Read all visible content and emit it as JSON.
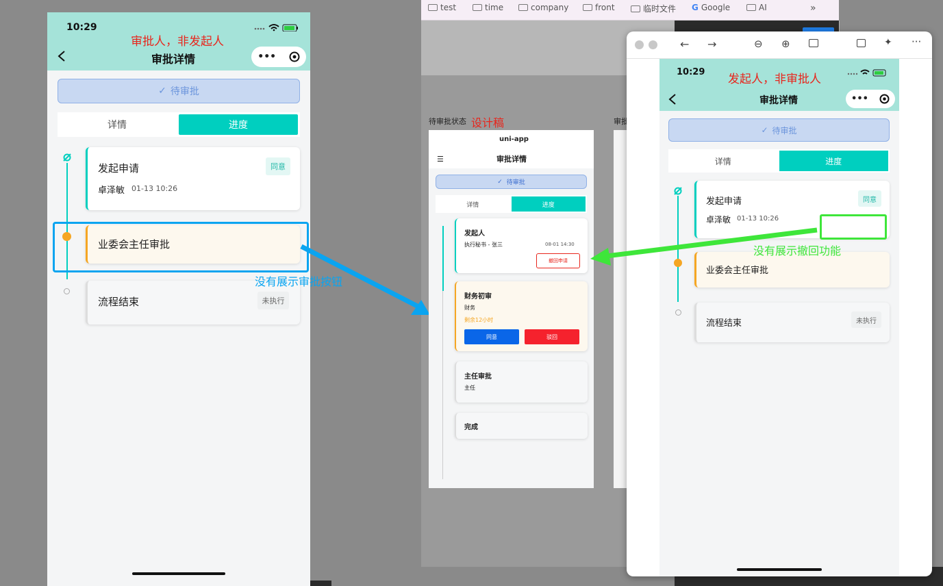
{
  "bookmarks": [
    "test",
    "time",
    "company",
    "front",
    "临时文件",
    "Google",
    "AI"
  ],
  "bookmarks_more": "»",
  "left_phone": {
    "time": "10:29",
    "annotation": "审批人，非发起人",
    "title": "审批详情",
    "pending": "待审批",
    "tabs": [
      "详情",
      "进度"
    ],
    "steps": [
      {
        "title": "发起申请",
        "person": "卓泽敏",
        "time": "01-13 10:26",
        "badge": "同意"
      },
      {
        "title": "业委会主任审批"
      },
      {
        "title": "流程结束",
        "badge": "未执行"
      }
    ]
  },
  "blue_note": "没有展示审批按钮",
  "mock": {
    "state_label": "待审批状态",
    "design_label": "设计稿",
    "side_label": "审批",
    "app_name": "uni-app",
    "title": "审批详情",
    "pending": "待审批",
    "tabs": [
      "详情",
      "进度"
    ],
    "steps": [
      {
        "title": "发起人",
        "line": "执行秘书 - 张三",
        "time": "08-01 14:30",
        "button": "撤回申请"
      },
      {
        "title": "财务初审",
        "line": "财务",
        "remain": "剩余12小时",
        "approve": "同意",
        "reject": "驳回"
      },
      {
        "title": "主任审批",
        "line": "主任"
      },
      {
        "title": "完成"
      }
    ]
  },
  "right_phone": {
    "time": "10:29",
    "annotation": "发起人，非审批人",
    "title": "审批详情",
    "pending": "待审批",
    "tabs": [
      "详情",
      "进度"
    ],
    "steps": [
      {
        "title": "发起申请",
        "person": "卓泽敏",
        "time": "01-13 10:26",
        "badge": "同意"
      },
      {
        "title": "业委会主任审批"
      },
      {
        "title": "流程结束",
        "badge": "未执行"
      }
    ]
  },
  "green_note": "没有展示撤回功能",
  "colors": {
    "teal": "#00cfbf",
    "header": "#a5e3d9",
    "orange": "#f5a623",
    "blue": "#0aa4f0",
    "green": "#3ee63a",
    "red": "#e8251c"
  }
}
